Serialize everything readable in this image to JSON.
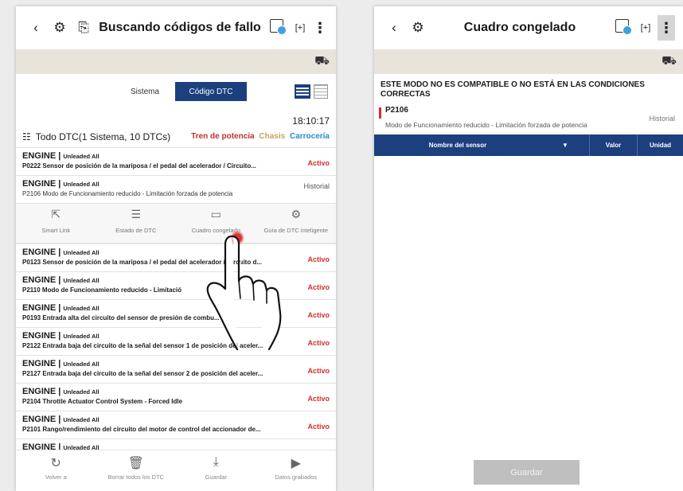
{
  "left": {
    "title": "Buscando códigos de fallo",
    "icons": {
      "back": "‹",
      "car_connect": "⚙",
      "export": "⎘",
      "dtc_scan": "dtc-scan-icon",
      "screenshot": "[+]",
      "more": "⋮",
      "car": "⛟"
    },
    "toggle": {
      "system": "Sistema",
      "dtc": "Código DTC"
    },
    "summary": {
      "time": "18:10:17",
      "all_label": "Todo DTC(1 Sistema, 10 DTCs)",
      "filter_powertrain": "Tren de potencia",
      "filter_chassis": "Chasis",
      "filter_body": "Carrocería"
    },
    "dtcs_top": [
      {
        "system": "ENGINE |",
        "variant": "Unleaded All",
        "desc": "P0222 Sensor de posición de la mariposa / el pedal del acelerador / Circuito...",
        "status": "Activo"
      },
      {
        "system": "ENGINE |",
        "variant": "Unleaded All",
        "desc": "P2106 Modo de Funcionamiento reducido - Limitación forzada de potencia",
        "status": "Historial"
      }
    ],
    "actions": [
      {
        "icon": "⇱",
        "label": "Smart Link"
      },
      {
        "icon": "☰",
        "label": "Estado de DTC"
      },
      {
        "icon": "▭",
        "label": "Cuadro congelado"
      },
      {
        "icon": "⚙",
        "label": "Guía de DTC inteligente"
      }
    ],
    "dtcs_bottom": [
      {
        "system": "ENGINE |",
        "variant": "Unleaded All",
        "desc": "P0123 Sensor de posición de la mariposa / el pedal del acelerador / Circuito d...",
        "status": "Activo"
      },
      {
        "system": "ENGINE |",
        "variant": "Unleaded All",
        "desc": "P2110 Modo de Funcionamiento reducido - Limitació",
        "status": "Activo"
      },
      {
        "system": "ENGINE |",
        "variant": "Unleaded All",
        "desc": "P0193 Entrada alta del circuito del sensor de presión de combu...",
        "status": "Activo"
      },
      {
        "system": "ENGINE |",
        "variant": "Unleaded All",
        "desc": "P2122 Entrada baja del circuito de la señal del sensor 1 de posición del aceler...",
        "status": "Activo"
      },
      {
        "system": "ENGINE |",
        "variant": "Unleaded All",
        "desc": "P2127 Entrada baja del circuito de la señal del sensor 2 de posición del aceler...",
        "status": "Activo"
      },
      {
        "system": "ENGINE |",
        "variant": "Unleaded All",
        "desc": "P2104 Throttle Actuator Control System - Forced Idle",
        "status": "Activo"
      },
      {
        "system": "ENGINE |",
        "variant": "Unleaded All",
        "desc": "P2101 Rango/rendimiento del circuito del motor de control del accionador de...",
        "status": "Activo"
      },
      {
        "system": "ENGINE |",
        "variant": "Unleaded All",
        "desc": "",
        "status": ""
      }
    ],
    "bottom_nav": [
      {
        "icon": "↻",
        "label": "Volver a"
      },
      {
        "icon": "🗑",
        "label": "Borrar todos los DTC"
      },
      {
        "icon": "⤓",
        "label": "Guardar"
      },
      {
        "icon": "▶",
        "label": "Datos grabados"
      }
    ]
  },
  "right": {
    "title": "Cuadro congelado",
    "warning": "ESTE MODO NO ES COMPATIBLE O NO ESTÁ EN LAS CONDICIONES CORRECTAS",
    "code": "P2106",
    "code_desc": "Modo de Funcionamiento reducido - Limitación forzada de potencia",
    "code_status": "Historial",
    "table_headers": {
      "name": "Nombre del sensor",
      "sort": "▼",
      "value": "Valor",
      "unit": "Unidad"
    },
    "save_label": "Guardar"
  },
  "colors": {
    "accent": "#1c3f7e",
    "active_red": "#d0312d",
    "body_blue": "#2a8dc8",
    "chassis": "#c8a060"
  }
}
